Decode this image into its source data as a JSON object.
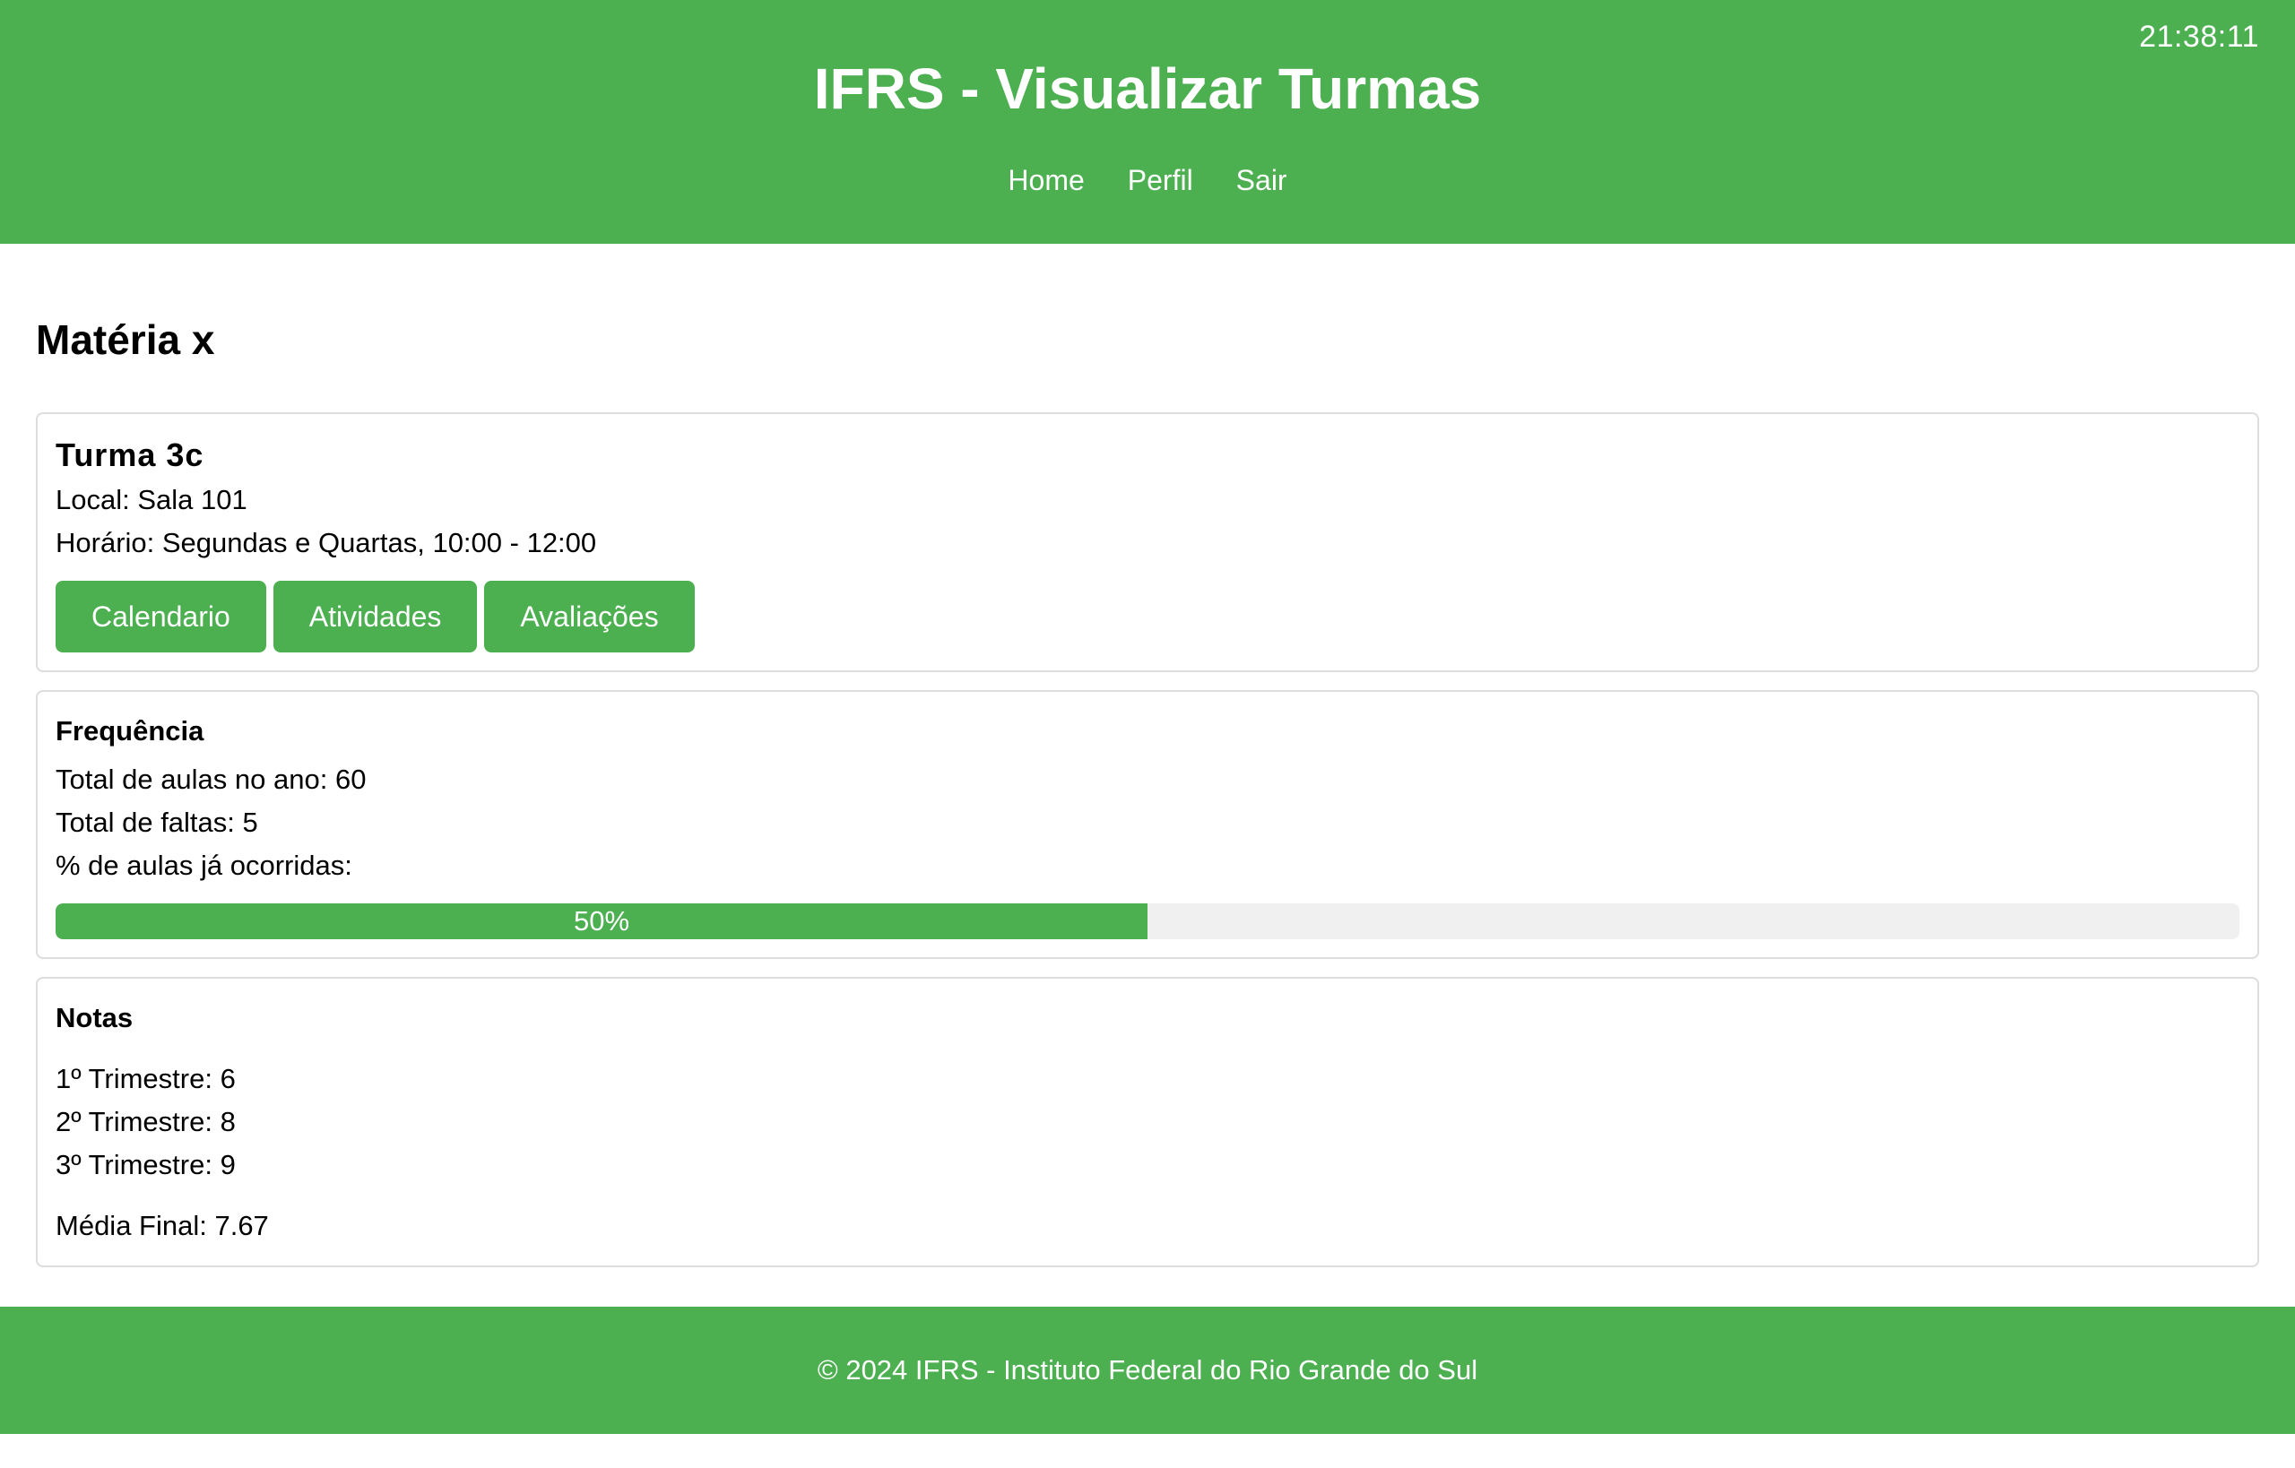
{
  "header": {
    "clock": "21:38:11",
    "title": "IFRS - Visualizar Turmas",
    "nav": [
      "Home",
      "Perfil",
      "Sair"
    ]
  },
  "subject": {
    "title": "Matéria x"
  },
  "class_card": {
    "name": "Turma 3c",
    "local": "Local: Sala 101",
    "schedule": "Horário: Segundas e Quartas, 10:00 - 12:00",
    "buttons": [
      "Calendario",
      "Atividades",
      "Avaliações"
    ]
  },
  "frequency": {
    "title": "Frequência",
    "total_classes": "Total de aulas no ano: 60",
    "total_absences": "Total de faltas: 5",
    "progress_label": "% de aulas já ocorridas:",
    "progress_percent": 50,
    "progress_text": "50%"
  },
  "grades": {
    "title": "Notas",
    "items": [
      "1º Trimestre: 6",
      "2º Trimestre: 8",
      "3º Trimestre: 9"
    ],
    "final": "Média Final: 7.67"
  },
  "footer": {
    "text": "© 2024 IFRS - Instituto Federal do Rio Grande do Sul"
  },
  "colors": {
    "brand_green": "#4caf50",
    "progress_track": "#f0f0f0",
    "card_border": "#dddddd"
  }
}
